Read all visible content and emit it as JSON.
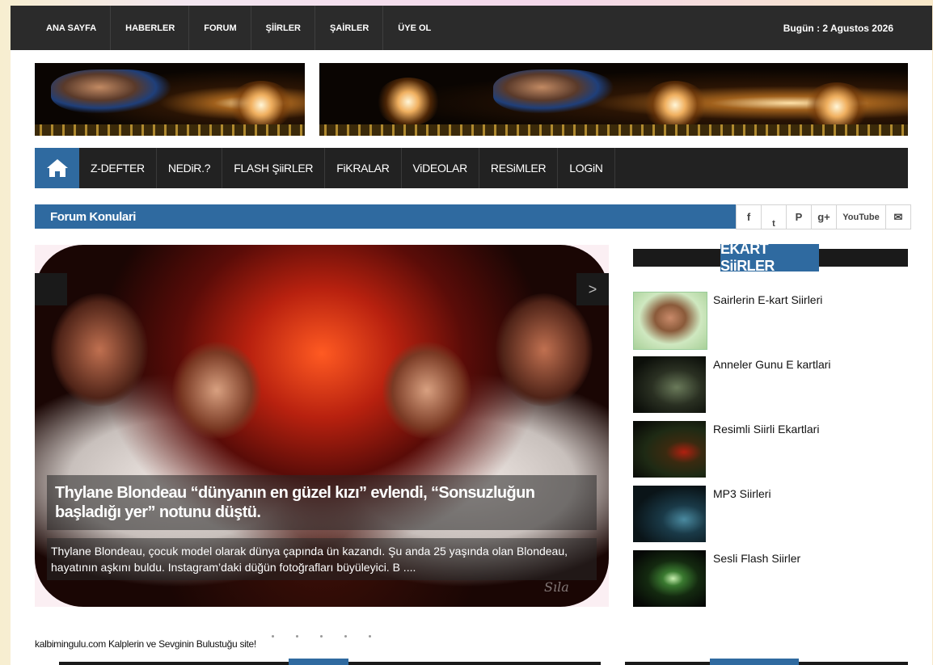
{
  "topnav": {
    "items": [
      "ANA SAYFA",
      "HABERLER",
      "FORUM",
      "ŞİİRLER",
      "ŞAİRLER",
      "ÜYE OL"
    ],
    "date": "Bugün : 2 Agustos 2026"
  },
  "mainnav": {
    "home_icon": "home-icon",
    "items": [
      "Z-DEFTER",
      "NEDiR.?",
      "FLASH ŞiiRLER",
      "FiKRALAR",
      "ViDEOLAR",
      "RESiMLER",
      "LOGiN"
    ]
  },
  "forum": {
    "title": "Forum Konulari",
    "social": [
      "f",
      "t",
      "P",
      "g+",
      "YouTube",
      "✉"
    ]
  },
  "slider": {
    "prev": "",
    "next": ">",
    "title": "Thylane Blondeau “dünyanın en güzel kızı” evlendi, “Sonsuzluğun başladığı yer” notunu düştü.",
    "description": "Thylane Blondeau, çocuk model olarak dünya çapında ün kazandı. Şu anda 25 yaşında olan Blondeau, hayatının aşkını buldu. Instagram’daki düğün fotoğrafları büyüleyici. B ....",
    "watermark": "Sıla"
  },
  "ekart": {
    "title": "EKART SiiRLER",
    "items": [
      {
        "label": "Sairlerin E-kart Siirleri"
      },
      {
        "label": "Anneler Gunu E kartlari"
      },
      {
        "label": "Resimli Siirli Ekartlari"
      },
      {
        "label": "MP3 Siirleri"
      },
      {
        "label": "Sesli Flash Siirler"
      }
    ]
  },
  "footer": {
    "text": "kalbimingulu.com Kalplerin ve Sevginin Bulustuğu site!"
  },
  "colors": {
    "accent": "#2f6aa0",
    "dark": "#2b2b2b"
  }
}
